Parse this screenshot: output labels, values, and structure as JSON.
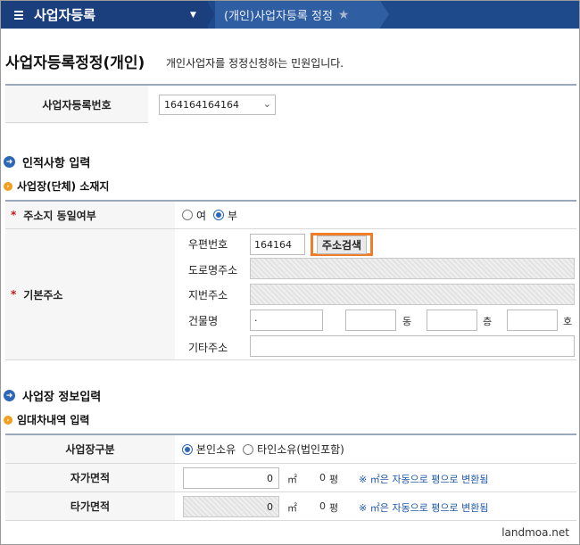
{
  "topbar": {
    "menu_title": "사업자등록",
    "breadcrumb": "(개인)사업자등록 정정"
  },
  "page": {
    "title": "사업자등록정정(개인)",
    "description": "개인사업자를 정정신청하는 민원입니다."
  },
  "business_number": {
    "label": "사업자등록번호",
    "selected": "164164164164"
  },
  "section_personal": {
    "title": "인적사항 입력",
    "sub_title": "사업장(단체) 소재지",
    "same_address": {
      "label": "주소지 동일여부",
      "options": [
        "여",
        "부"
      ],
      "selected": "부"
    },
    "address": {
      "label": "기본주소",
      "postal_label": "우편번호",
      "postal_value": "164164",
      "search_button": "주소검색",
      "road_label": "도로명주소",
      "lot_label": "지번주소",
      "building_label": "건물명",
      "building_value": "·",
      "dong_unit": "동",
      "floor_unit": "층",
      "room_unit": "호",
      "other_label": "기타주소"
    }
  },
  "section_business": {
    "title": "사업장 정보입력",
    "sub_title": "임대차내역 입력",
    "type": {
      "label": "사업장구분",
      "options": [
        "본인소유",
        "타인소유(법인포함)"
      ],
      "selected": "본인소유"
    },
    "own_area": {
      "label": "자가면적",
      "value": "0",
      "unit_m2": "㎡",
      "pyeong_value": "0",
      "pyeong_unit": "평",
      "hint": "※ ㎡은 자동으로 평으로 변환됨"
    },
    "other_area": {
      "label": "타가면적",
      "value": "0",
      "unit_m2": "㎡",
      "pyeong_value": "0",
      "pyeong_unit": "평",
      "hint": "※ ㎡은 자동으로 평으로 변환됨"
    }
  },
  "watermark": "landmoa.net",
  "colors": {
    "nav_dark": "#1a3f7c",
    "nav": "#2f5ea3",
    "accent_orange": "#f07d2a",
    "radio_blue": "#2e67b7",
    "required_red": "#c4161c"
  }
}
